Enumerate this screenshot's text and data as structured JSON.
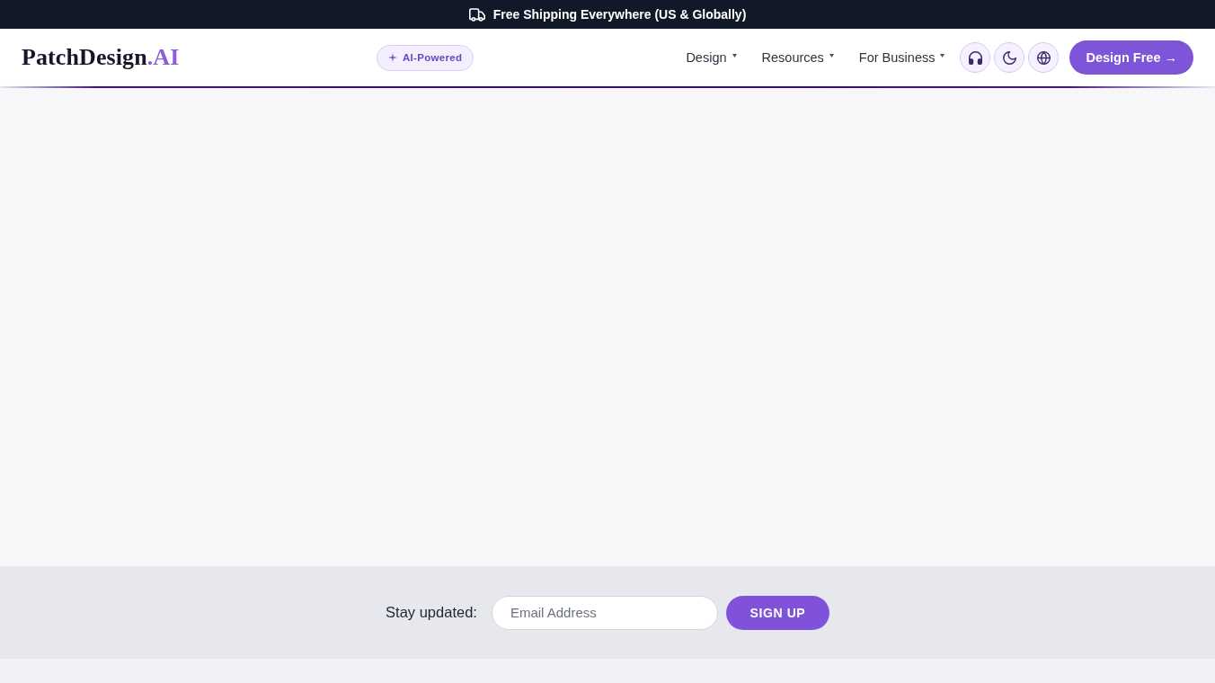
{
  "announcement_bar": {
    "text": "Free Shipping Everywhere (US & Globally)"
  },
  "header": {
    "logo": {
      "name": "PatchDesign",
      "suffix": ".AI"
    },
    "badge": "AI-Powered",
    "nav": [
      {
        "label": "Design",
        "dropdown": true
      },
      {
        "label": "Resources",
        "dropdown": true
      },
      {
        "label": "For Business",
        "dropdown": true
      }
    ],
    "cta": "Design Free →"
  },
  "newsletter": {
    "label": "Stay updated:",
    "email": {
      "placeholder": "Email Address"
    },
    "button": "SIGN UP"
  }
}
